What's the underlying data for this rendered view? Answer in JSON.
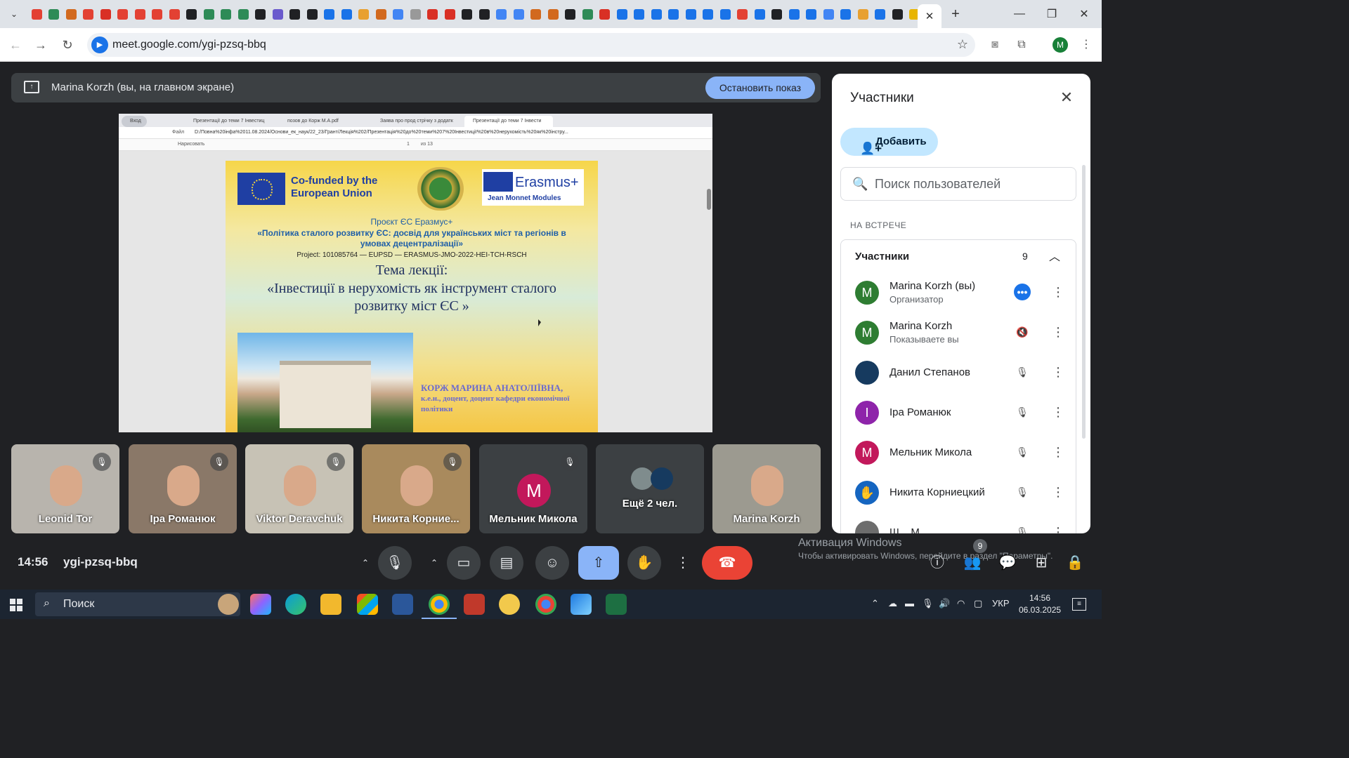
{
  "browser": {
    "url": "meet.google.com/ygi-pzsq-bbq",
    "profile_initial": "M",
    "favicon_colors": [
      "#e34133",
      "#2e8b57",
      "#d2691e",
      "#e34133",
      "#d93025",
      "#e34133",
      "#e34133",
      "#e34133",
      "#e34133",
      "#202124",
      "#2e8b57",
      "#2e8b57",
      "#2e8b57",
      "#202124",
      "#6a5acd",
      "#202124",
      "#202124",
      "#1a73e8",
      "#1a73e8",
      "#e8a030",
      "#d2691e",
      "#4285f4",
      "#999999",
      "#d93025",
      "#d93025",
      "#202124",
      "#202124",
      "#4285f4",
      "#4285f4",
      "#d2691e",
      "#d2691e",
      "#202124",
      "#2e8b57",
      "#d93025",
      "#1a73e8",
      "#1a73e8",
      "#1a73e8",
      "#1a73e8",
      "#1a73e8",
      "#1a73e8",
      "#1a73e8",
      "#e34133",
      "#1a73e8",
      "#202124",
      "#1a73e8",
      "#1a73e8",
      "#4285f4",
      "#1a73e8",
      "#e8a030",
      "#1a73e8",
      "#202124",
      "#e8b500"
    ]
  },
  "banner": {
    "text": "Marina Korzh (вы, на главном экране)",
    "stop_label": "Остановить показ"
  },
  "shared_screen": {
    "tabs": [
      "Вход",
      "Презентації до теми 7 Інвестиц",
      "позов до Корж М.А.pdf",
      "Заява про прод стрічку з додатк",
      "Презентації до теми 7 Інвести"
    ],
    "file_label": "Файл",
    "file_url": "D:/Повна%20інфа%2011.08.2024/Основи_ек_наук/22_23/Грант/Лекція%202/Презентація%20до%20теми%207%20Інвестиції%20в%20нерухомість%20як%20інстру...",
    "draw_label": "Нарисовать",
    "page_number": "1",
    "page_total": "из 13",
    "slide": {
      "cofund": "Co-funded by the European Union",
      "erasmus_word": "Erasmus+",
      "erasmus_sub": "Jean Monnet Modules",
      "project_line1": "Проєкт ЄС Еразмус+",
      "project_line2": "«Політика сталого розвитку ЄС: досвід для українських міст та регіонів в умовах децентралізації»",
      "project_line3": "Project: 101085764 — EUPSD — ERASMUS-JMO-2022-HEI-TCH-RSCH",
      "topic_heading": "Тема лекції:",
      "topic_text": "«Інвестиції в нерухомість як інструмент сталого розвитку міст ЄС »",
      "author_name": "КОРЖ МАРИНА АНАТОЛІЇВНА,",
      "author_title": "к.е.н., доцент, доцент кафедри економічної політики"
    }
  },
  "tiles": [
    {
      "name": "Leonid Tor",
      "muted": true,
      "bg": "#b8b4ad"
    },
    {
      "name": "Іра Романюк",
      "muted": true,
      "bg": "#8a7868"
    },
    {
      "name": "Viktor Deravchuk",
      "muted": true,
      "bg": "#c7c2b5"
    },
    {
      "name": "Никита Корние...",
      "muted": true,
      "bg": "#a98a5d"
    },
    {
      "name": "Мельник Микола",
      "muted": true,
      "avatar": "M",
      "bg": "#3c4043"
    },
    {
      "name": "Ещё 2 чел.",
      "muted": false,
      "bg": "#3c4043"
    },
    {
      "name": "Marina Korzh",
      "muted": false,
      "bg": "#9c9a90"
    }
  ],
  "bottom_bar": {
    "time": "14:56",
    "meeting_code": "ygi-pzsq-bbq",
    "participants_badge": "9"
  },
  "watermark": {
    "line1": "Активация Windows",
    "line2": "Чтобы активировать Windows, перейдите в раздел \"Параметры\"."
  },
  "panel": {
    "title": "Участники",
    "add_label": "Добавить",
    "search_placeholder": "Поиск пользователей",
    "section_label": "НА ВСТРЕЧЕ",
    "group_label": "Участники",
    "group_count": "9",
    "participants": [
      {
        "initial": "M",
        "color": "#2e7d32",
        "name": "Marina Korzh (вы)",
        "sub": "Организатор",
        "state": "•••"
      },
      {
        "initial": "M",
        "color": "#2e7d32",
        "name": "Marina Korzh",
        "sub": "Показываете вы",
        "state": "🔇"
      },
      {
        "initial": "",
        "color": "#163a5f",
        "name": "Данил Степанов",
        "sub": "",
        "state": "🎙"
      },
      {
        "initial": "I",
        "color": "#8e24aa",
        "name": "Іра Романюк",
        "sub": "",
        "state": "🎙"
      },
      {
        "initial": "M",
        "color": "#c2185b",
        "name": "Мельник Микола",
        "sub": "",
        "state": "🎙"
      },
      {
        "initial": "✋",
        "color": "#1565c0",
        "name": "Никита Корниецкий",
        "sub": "",
        "state": "🎙"
      },
      {
        "initial": "",
        "color": "#6d6d6d",
        "name": "Ш... М...",
        "sub": "",
        "state": "🎙"
      }
    ]
  },
  "taskbar": {
    "search_label": "Поиск",
    "lang": "УКР",
    "time": "14:56",
    "date": "06.03.2025"
  }
}
